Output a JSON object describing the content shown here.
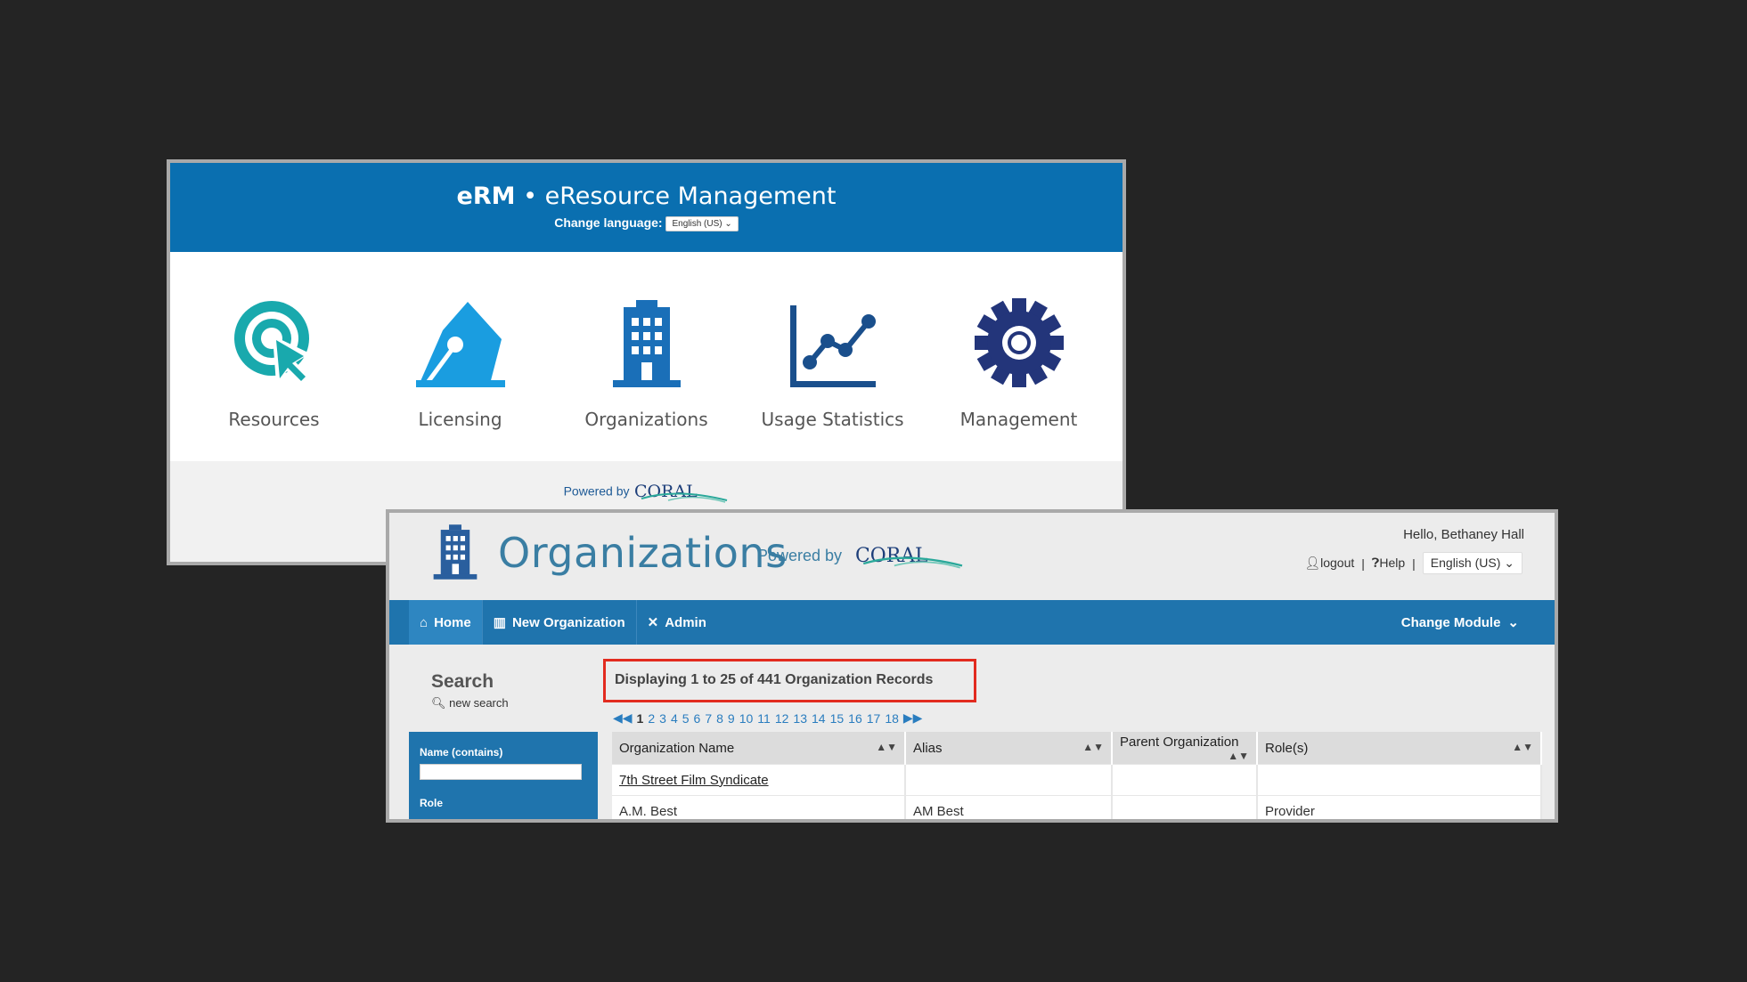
{
  "erm": {
    "title_bold": "eRM",
    "title_rest": " • eResource Management",
    "change_language_label": "Change language:",
    "language_value": "English (US)",
    "modules": [
      {
        "label": "Resources",
        "icon": "target-cursor-icon",
        "color": "#19a9ad"
      },
      {
        "label": "Licensing",
        "icon": "pen-nib-icon",
        "color": "#1a9de0"
      },
      {
        "label": "Organizations",
        "icon": "building-icon",
        "color": "#1a6fb8"
      },
      {
        "label": "Usage Statistics",
        "icon": "line-chart-icon",
        "color": "#1a4f8c"
      },
      {
        "label": "Management",
        "icon": "gear-icon",
        "color": "#23357a"
      }
    ],
    "powered_by": "Powered by",
    "coral_logo": "CORAL"
  },
  "org": {
    "app_title": "Organizations",
    "powered_by": "Powered by",
    "coral_logo": "CORAL",
    "greeting": "Hello, Bethaney Hall",
    "logout": "logout",
    "help": "Help",
    "language": "English (US)",
    "nav": {
      "home": "Home",
      "new_org": "New Organization",
      "admin": "Admin",
      "change_module": "Change Module"
    },
    "search": {
      "heading": "Search",
      "new_search": "new search",
      "name_label": "Name (contains)",
      "name_value": "",
      "role_label": "Role"
    },
    "records_text": "Displaying 1 to 25 of 441 Organization Records",
    "pages": [
      "1",
      "2",
      "3",
      "4",
      "5",
      "6",
      "7",
      "8",
      "9",
      "10",
      "11",
      "12",
      "13",
      "14",
      "15",
      "16",
      "17",
      "18"
    ],
    "current_page": "1",
    "columns": [
      "Organization Name",
      "Alias",
      "Parent Organization",
      "Role(s)"
    ],
    "sort_glyph": "▲▼",
    "rows": [
      {
        "name": "7th Street Film Syndicate",
        "alias": "",
        "parent": "",
        "roles": ""
      },
      {
        "name": "A.M. Best",
        "alias": "AM Best",
        "parent": "",
        "roles": "Provider"
      }
    ]
  },
  "colors": {
    "erm_header": "#0a6fb0",
    "nav_bar": "#1f74ad",
    "highlight_box": "#e22b1f",
    "background": "#242424"
  }
}
